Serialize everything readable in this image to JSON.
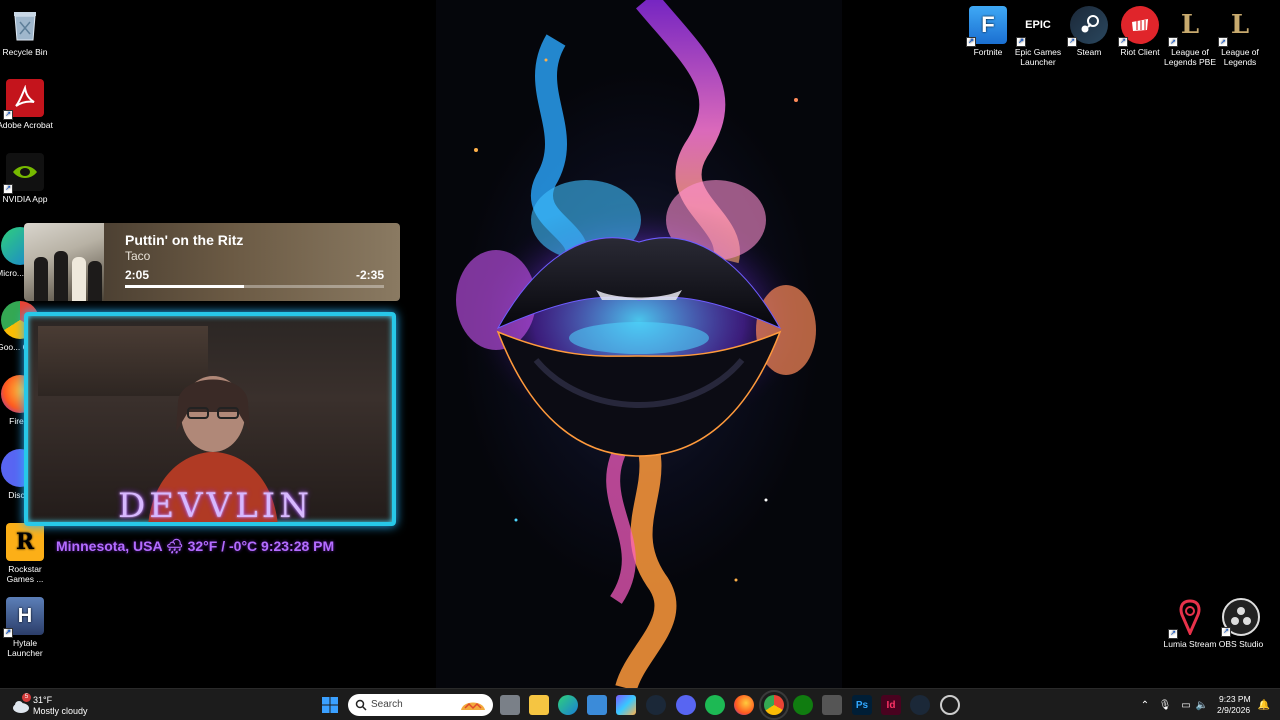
{
  "desktop_left_icons": [
    {
      "name": "recycle-bin",
      "label": "Recycle Bin"
    },
    {
      "name": "adobe-acrobat",
      "label": "Adobe Acrobat"
    },
    {
      "name": "nvidia-app",
      "label": "NVIDIA App"
    },
    {
      "name": "microsoft-edge",
      "label": "Micro... Ed..."
    },
    {
      "name": "google-chrome",
      "label": "Goo... Chr..."
    },
    {
      "name": "firefox",
      "label": "Fire..."
    },
    {
      "name": "discord",
      "label": "Disc..."
    },
    {
      "name": "rockstar-games",
      "label": "Rockstar Games ..."
    },
    {
      "name": "hytale-launcher",
      "label": "Hytale Launcher"
    }
  ],
  "desktop_right_icons": [
    {
      "name": "fortnite",
      "label": "Fortnite"
    },
    {
      "name": "epic-games",
      "label": "Epic Games Launcher"
    },
    {
      "name": "steam",
      "label": "Steam"
    },
    {
      "name": "riot-client",
      "label": "Riot Client"
    },
    {
      "name": "lol-pbe",
      "label": "League of Legends PBE"
    },
    {
      "name": "lol",
      "label": "League of Legends"
    },
    {
      "name": "lumia-stream",
      "label": "Lumia Stream"
    },
    {
      "name": "obs-studio",
      "label": "OBS Studio"
    }
  ],
  "music": {
    "title": "Puttin' on the Ritz",
    "artist": "Taco",
    "elapsed": "2:05",
    "remaining": "-2:35",
    "progress_percent": 46
  },
  "webcam": {
    "overlay_name": "DEVVLIN",
    "location_line": "Minnesota, USA 🌧 32°F / -0°C  9:23:28 PM"
  },
  "taskbar": {
    "weather_badge": "5",
    "weather_temp": "31°F",
    "weather_condition": "Mostly cloudy",
    "search_placeholder": "Search",
    "clock_time": "9:23 PM",
    "clock_date": "2/9/2026"
  },
  "colors": {
    "cam_border": "#27c8e8",
    "overlay_purple": "#b46cff",
    "taskbar_bg": "#1c1c1c"
  }
}
